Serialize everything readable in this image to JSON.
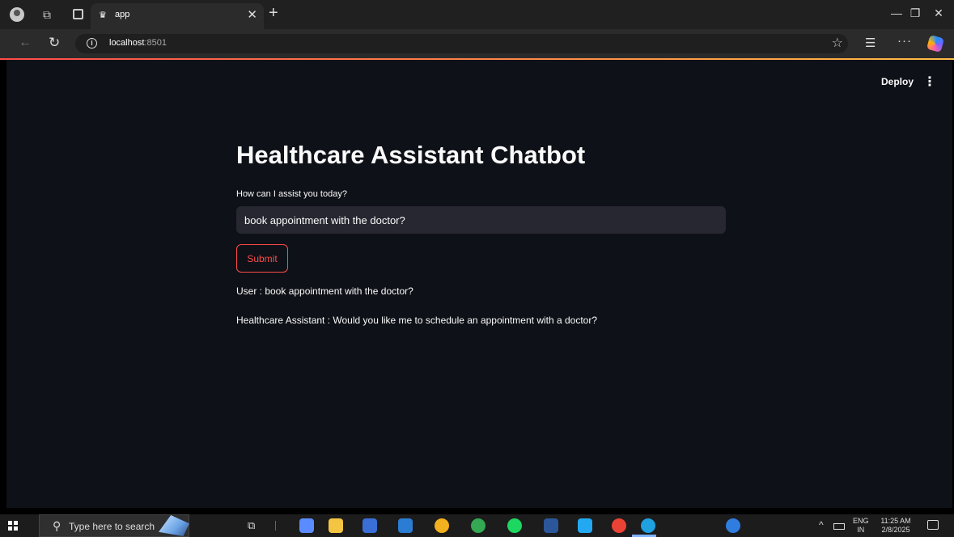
{
  "browser": {
    "tab_title": "app",
    "url_host": "localhost",
    "url_port": ":8501",
    "icons": {
      "profile": "profile-icon",
      "workspaces": "workspaces-icon",
      "tab_actions": "tab-actions-icon",
      "favicon": "streamlit-crown-icon",
      "close_tab": "close-icon",
      "new_tab": "plus-icon",
      "back": "back-arrow-icon",
      "reload": "reload-icon",
      "site_info": "info-icon",
      "favorite": "star-icon",
      "favorites": "favorites-icon",
      "more": "ellipsis-icon",
      "copilot": "copilot-icon"
    },
    "glyphs": {
      "close_tab": "✕",
      "new_tab": "+",
      "back": "←",
      "reload": "↻",
      "info": "i",
      "star": "☆",
      "favorites": "☰",
      "more": "···",
      "minimize": "—",
      "restore": "❐",
      "close_window": "✕"
    }
  },
  "header": {
    "deploy_label": "Deploy",
    "menu_glyph": "⋮"
  },
  "main": {
    "title": "Healthcare Assistant Chatbot",
    "input_label": "How can I assist you today?",
    "input_value": "book appointment with the doctor?",
    "submit_label": "Submit",
    "messages": [
      "User : book appointment with the doctor?",
      "Healthcare Assistant : Would you like me to schedule an appointment with a doctor?"
    ]
  },
  "taskbar": {
    "search_placeholder": "Type here to search",
    "search_glyph": "⚲",
    "task_view_glyph": "⧉",
    "tray_chevron": "^",
    "language": "ENG",
    "region": "IN",
    "time": "11:25 AM",
    "date": "2/8/2025",
    "apps": [
      {
        "name": "copilot-app-icon",
        "color": "#5b8cff"
      },
      {
        "name": "file-explorer-icon",
        "color": "#f4c542"
      },
      {
        "name": "store-icon",
        "color": "#3b6fd8"
      },
      {
        "name": "outlook-icon",
        "color": "#2b7cd3"
      },
      {
        "name": "chrome-icon",
        "color": "#f2b01e"
      },
      {
        "name": "chrome-profile-icon",
        "color": "#34a853"
      },
      {
        "name": "spotify-icon",
        "color": "#1ed760"
      },
      {
        "name": "word-icon",
        "color": "#2b579a"
      },
      {
        "name": "vscode-icon",
        "color": "#23a9f2"
      },
      {
        "name": "chrome-icon-2",
        "color": "#ea4335"
      },
      {
        "name": "edge-icon",
        "color": "#1fa0e0"
      },
      {
        "name": "help-icon",
        "color": "#2f7de1"
      }
    ]
  },
  "colors": {
    "app_background": "#0e1117",
    "accent": "#ff4b4b",
    "input_background": "#262730"
  }
}
